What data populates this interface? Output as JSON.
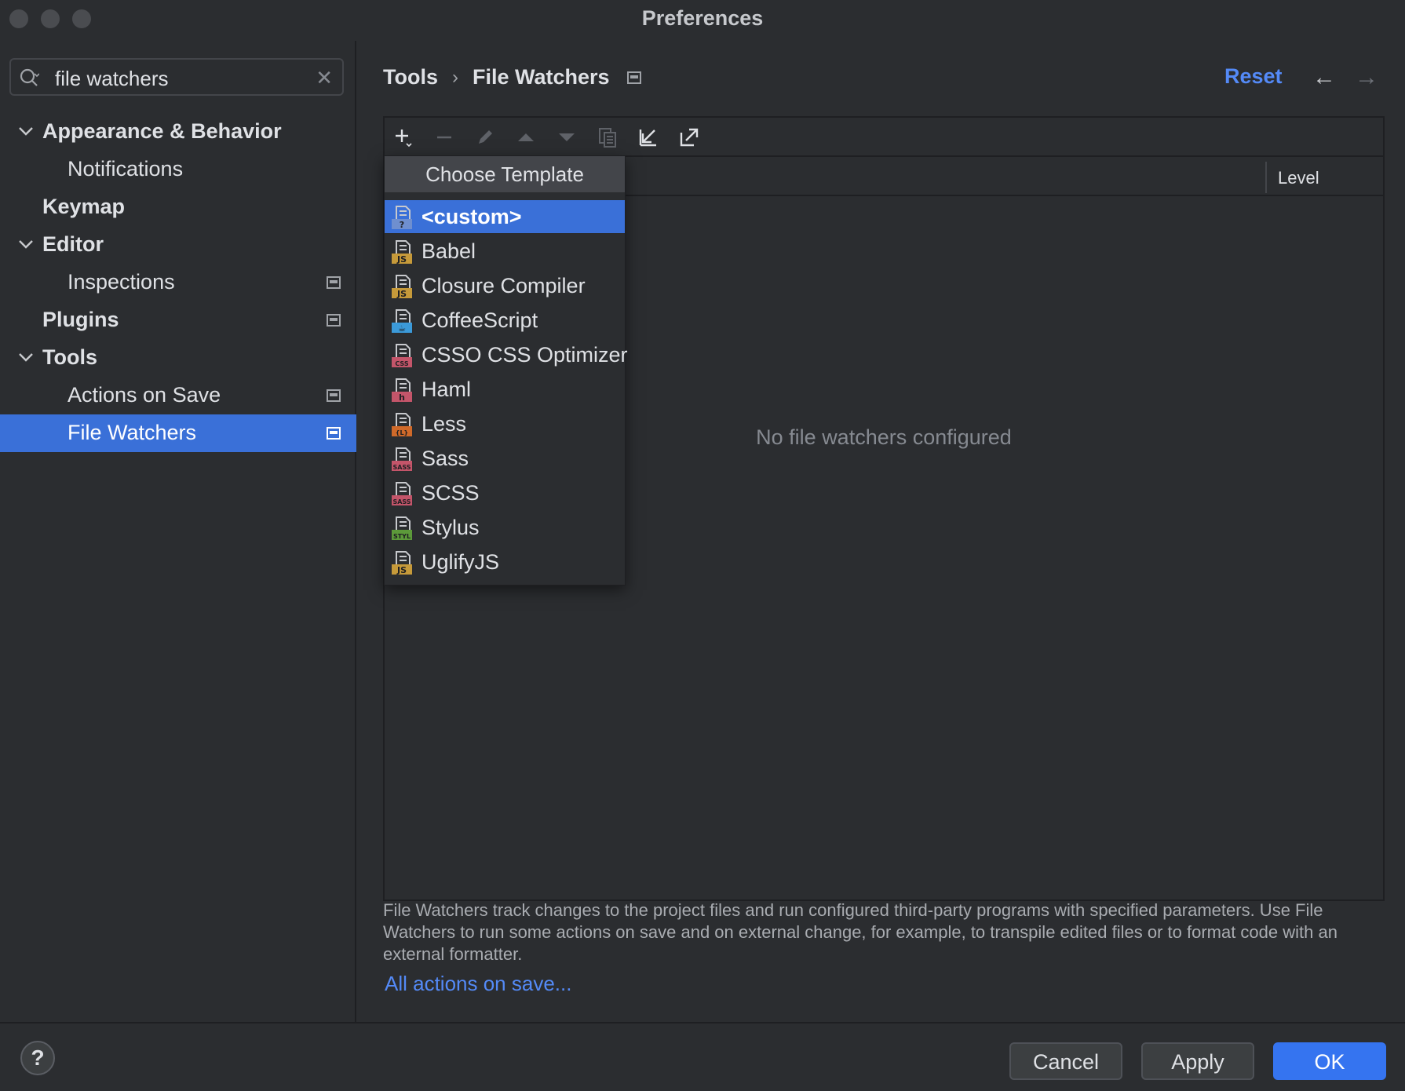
{
  "window": {
    "title": "Preferences"
  },
  "search": {
    "value": "file watchers"
  },
  "sidebar": {
    "items": [
      {
        "label": "Appearance & Behavior",
        "bold": true,
        "chevron": true,
        "indent": 0
      },
      {
        "label": "Notifications",
        "bold": false,
        "chevron": false,
        "indent": 1
      },
      {
        "label": "Keymap",
        "bold": true,
        "chevron": false,
        "indent": 0
      },
      {
        "label": "Editor",
        "bold": true,
        "chevron": true,
        "indent": 0
      },
      {
        "label": "Inspections",
        "bold": false,
        "chevron": false,
        "indent": 1,
        "pin": true
      },
      {
        "label": "Plugins",
        "bold": true,
        "chevron": false,
        "indent": 0,
        "pin": true
      },
      {
        "label": "Tools",
        "bold": true,
        "chevron": true,
        "indent": 0
      },
      {
        "label": "Actions on Save",
        "bold": false,
        "chevron": false,
        "indent": 1,
        "pin": true
      },
      {
        "label": "File Watchers",
        "bold": false,
        "chevron": false,
        "indent": 1,
        "pin": true,
        "selected": true
      }
    ]
  },
  "breadcrumb": {
    "parent": "Tools",
    "separator": "›",
    "current": "File Watchers"
  },
  "header": {
    "reset_label": "Reset",
    "back_icon": "←",
    "forward_icon": "→"
  },
  "table": {
    "level_header": "Level",
    "empty_text": "No file watchers configured"
  },
  "popup": {
    "title": "Choose Template",
    "items": [
      {
        "label": "<custom>",
        "badge": "?",
        "badge_color": "#6f8fcf",
        "selected": true
      },
      {
        "label": "Babel",
        "badge": "JS",
        "badge_color": "#c69a3a"
      },
      {
        "label": "Closure Compiler",
        "badge": "JS",
        "badge_color": "#c69a3a"
      },
      {
        "label": "CoffeeScript",
        "badge": "☕",
        "badge_color": "#3b9ad9"
      },
      {
        "label": "CSSO CSS Optimizer",
        "badge": "CSS",
        "badge_color": "#c4556a"
      },
      {
        "label": "Haml",
        "badge": "h",
        "badge_color": "#c4556a"
      },
      {
        "label": "Less",
        "badge": "{L}",
        "badge_color": "#d06a2a"
      },
      {
        "label": "Sass",
        "badge": "SASS",
        "badge_color": "#c4556a"
      },
      {
        "label": "SCSS",
        "badge": "SASS",
        "badge_color": "#c4556a"
      },
      {
        "label": "Stylus",
        "badge": "STYL",
        "badge_color": "#5c9a3a"
      },
      {
        "label": "UglifyJS",
        "badge": "JS",
        "badge_color": "#c69a3a"
      }
    ]
  },
  "description": "File Watchers track changes to the project files and run configured third-party programs with specified parameters. Use File Watchers to run some actions on save and on external change, for example, to transpile edited files or to format code with an external formatter.",
  "link_label": "All actions on save...",
  "footer": {
    "help_label": "?",
    "cancel_label": "Cancel",
    "apply_label": "Apply",
    "ok_label": "OK"
  },
  "colors": {
    "accent": "#3574f0",
    "link": "#548af7",
    "selection": "#3a70d8"
  }
}
